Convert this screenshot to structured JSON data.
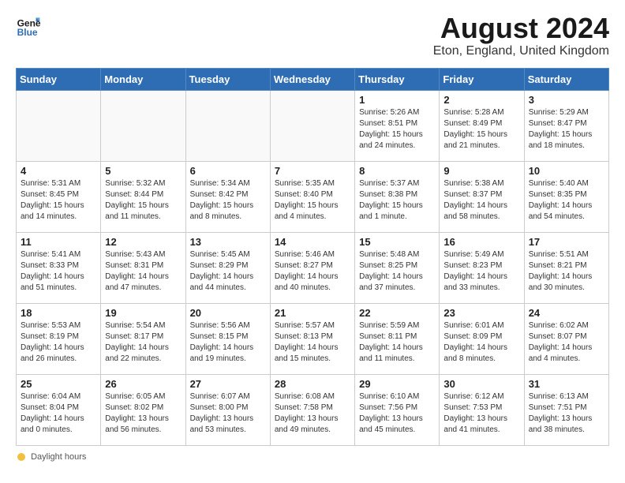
{
  "header": {
    "logo_line1": "General",
    "logo_line2": "Blue",
    "month_year": "August 2024",
    "location": "Eton, England, United Kingdom"
  },
  "days_of_week": [
    "Sunday",
    "Monday",
    "Tuesday",
    "Wednesday",
    "Thursday",
    "Friday",
    "Saturday"
  ],
  "weeks": [
    [
      {
        "day": "",
        "info": ""
      },
      {
        "day": "",
        "info": ""
      },
      {
        "day": "",
        "info": ""
      },
      {
        "day": "",
        "info": ""
      },
      {
        "day": "1",
        "info": "Sunrise: 5:26 AM\nSunset: 8:51 PM\nDaylight: 15 hours\nand 24 minutes."
      },
      {
        "day": "2",
        "info": "Sunrise: 5:28 AM\nSunset: 8:49 PM\nDaylight: 15 hours\nand 21 minutes."
      },
      {
        "day": "3",
        "info": "Sunrise: 5:29 AM\nSunset: 8:47 PM\nDaylight: 15 hours\nand 18 minutes."
      }
    ],
    [
      {
        "day": "4",
        "info": "Sunrise: 5:31 AM\nSunset: 8:45 PM\nDaylight: 15 hours\nand 14 minutes."
      },
      {
        "day": "5",
        "info": "Sunrise: 5:32 AM\nSunset: 8:44 PM\nDaylight: 15 hours\nand 11 minutes."
      },
      {
        "day": "6",
        "info": "Sunrise: 5:34 AM\nSunset: 8:42 PM\nDaylight: 15 hours\nand 8 minutes."
      },
      {
        "day": "7",
        "info": "Sunrise: 5:35 AM\nSunset: 8:40 PM\nDaylight: 15 hours\nand 4 minutes."
      },
      {
        "day": "8",
        "info": "Sunrise: 5:37 AM\nSunset: 8:38 PM\nDaylight: 15 hours\nand 1 minute."
      },
      {
        "day": "9",
        "info": "Sunrise: 5:38 AM\nSunset: 8:37 PM\nDaylight: 14 hours\nand 58 minutes."
      },
      {
        "day": "10",
        "info": "Sunrise: 5:40 AM\nSunset: 8:35 PM\nDaylight: 14 hours\nand 54 minutes."
      }
    ],
    [
      {
        "day": "11",
        "info": "Sunrise: 5:41 AM\nSunset: 8:33 PM\nDaylight: 14 hours\nand 51 minutes."
      },
      {
        "day": "12",
        "info": "Sunrise: 5:43 AM\nSunset: 8:31 PM\nDaylight: 14 hours\nand 47 minutes."
      },
      {
        "day": "13",
        "info": "Sunrise: 5:45 AM\nSunset: 8:29 PM\nDaylight: 14 hours\nand 44 minutes."
      },
      {
        "day": "14",
        "info": "Sunrise: 5:46 AM\nSunset: 8:27 PM\nDaylight: 14 hours\nand 40 minutes."
      },
      {
        "day": "15",
        "info": "Sunrise: 5:48 AM\nSunset: 8:25 PM\nDaylight: 14 hours\nand 37 minutes."
      },
      {
        "day": "16",
        "info": "Sunrise: 5:49 AM\nSunset: 8:23 PM\nDaylight: 14 hours\nand 33 minutes."
      },
      {
        "day": "17",
        "info": "Sunrise: 5:51 AM\nSunset: 8:21 PM\nDaylight: 14 hours\nand 30 minutes."
      }
    ],
    [
      {
        "day": "18",
        "info": "Sunrise: 5:53 AM\nSunset: 8:19 PM\nDaylight: 14 hours\nand 26 minutes."
      },
      {
        "day": "19",
        "info": "Sunrise: 5:54 AM\nSunset: 8:17 PM\nDaylight: 14 hours\nand 22 minutes."
      },
      {
        "day": "20",
        "info": "Sunrise: 5:56 AM\nSunset: 8:15 PM\nDaylight: 14 hours\nand 19 minutes."
      },
      {
        "day": "21",
        "info": "Sunrise: 5:57 AM\nSunset: 8:13 PM\nDaylight: 14 hours\nand 15 minutes."
      },
      {
        "day": "22",
        "info": "Sunrise: 5:59 AM\nSunset: 8:11 PM\nDaylight: 14 hours\nand 11 minutes."
      },
      {
        "day": "23",
        "info": "Sunrise: 6:01 AM\nSunset: 8:09 PM\nDaylight: 14 hours\nand 8 minutes."
      },
      {
        "day": "24",
        "info": "Sunrise: 6:02 AM\nSunset: 8:07 PM\nDaylight: 14 hours\nand 4 minutes."
      }
    ],
    [
      {
        "day": "25",
        "info": "Sunrise: 6:04 AM\nSunset: 8:04 PM\nDaylight: 14 hours\nand 0 minutes."
      },
      {
        "day": "26",
        "info": "Sunrise: 6:05 AM\nSunset: 8:02 PM\nDaylight: 13 hours\nand 56 minutes."
      },
      {
        "day": "27",
        "info": "Sunrise: 6:07 AM\nSunset: 8:00 PM\nDaylight: 13 hours\nand 53 minutes."
      },
      {
        "day": "28",
        "info": "Sunrise: 6:08 AM\nSunset: 7:58 PM\nDaylight: 13 hours\nand 49 minutes."
      },
      {
        "day": "29",
        "info": "Sunrise: 6:10 AM\nSunset: 7:56 PM\nDaylight: 13 hours\nand 45 minutes."
      },
      {
        "day": "30",
        "info": "Sunrise: 6:12 AM\nSunset: 7:53 PM\nDaylight: 13 hours\nand 41 minutes."
      },
      {
        "day": "31",
        "info": "Sunrise: 6:13 AM\nSunset: 7:51 PM\nDaylight: 13 hours\nand 38 minutes."
      }
    ]
  ],
  "footer": {
    "daylight_label": "Daylight hours"
  }
}
